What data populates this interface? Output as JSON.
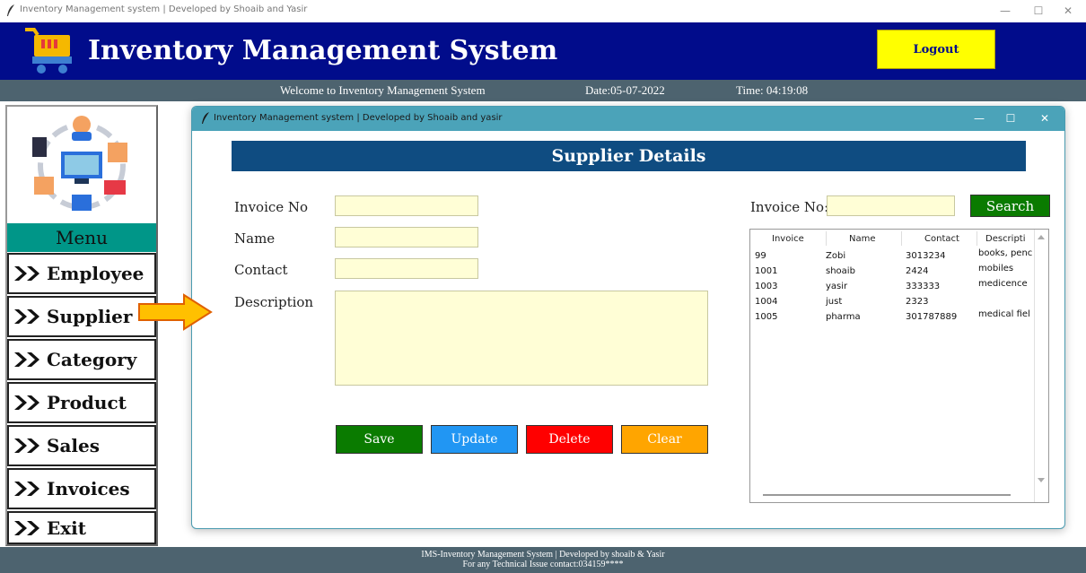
{
  "os_window": {
    "title": "Inventory Management system | Developed by Shoaib and Yasir",
    "controls": [
      "—",
      "☐",
      "✕"
    ]
  },
  "header": {
    "title": "Inventory Management System",
    "logout_label": "Logout",
    "colors": {
      "background": "#010c8b",
      "logout": "#ffff00"
    }
  },
  "welcome_bar": {
    "welcome": "Welcome to Inventory Management System",
    "date": "Date:05-07-2022",
    "time": "Time: 04:19:08"
  },
  "menu": {
    "label": "Menu",
    "items": [
      {
        "label": "Employee"
      },
      {
        "label": "Supplier"
      },
      {
        "label": "Category"
      },
      {
        "label": "Product"
      },
      {
        "label": "Sales"
      },
      {
        "label": "Invoices"
      },
      {
        "label": "Exit"
      }
    ],
    "icon": "double-chevron-right-icon"
  },
  "child_window": {
    "title": "Inventory Management system | Developed by Shoaib and yasir",
    "controls": [
      "—",
      "☐",
      "✕"
    ],
    "page_title": "Supplier Details",
    "form": {
      "invoice_label": "Invoice No",
      "name_label": "Name",
      "contact_label": "Contact",
      "description_label": "Description",
      "invoice_value": "",
      "name_value": "",
      "contact_value": "",
      "description_value": ""
    },
    "buttons": {
      "save": "Save",
      "update": "Update",
      "delete": "Delete",
      "clear": "Clear"
    },
    "search": {
      "label": "Invoice No:",
      "value": "",
      "button": "Search"
    },
    "table": {
      "columns": [
        "Invoice",
        "Name",
        "Contact",
        "Descripti"
      ],
      "rows": [
        {
          "invoice": "99",
          "name": "Zobi",
          "contact": "3013234",
          "description": "books, penc"
        },
        {
          "invoice": "1001",
          "name": "shoaib",
          "contact": "2424",
          "description": "mobiles"
        },
        {
          "invoice": "1003",
          "name": "yasir",
          "contact": "333333",
          "description": "medicence"
        },
        {
          "invoice": "1004",
          "name": "just",
          "contact": "2323",
          "description": ""
        },
        {
          "invoice": "1005",
          "name": "pharma",
          "contact": "301787889",
          "description": "medical fiel"
        }
      ]
    }
  },
  "footer": {
    "line1": "IMS-Inventory Management System | Developed by shoaib & Yasir",
    "line2": "For any Technical Issue contact:034159****"
  }
}
